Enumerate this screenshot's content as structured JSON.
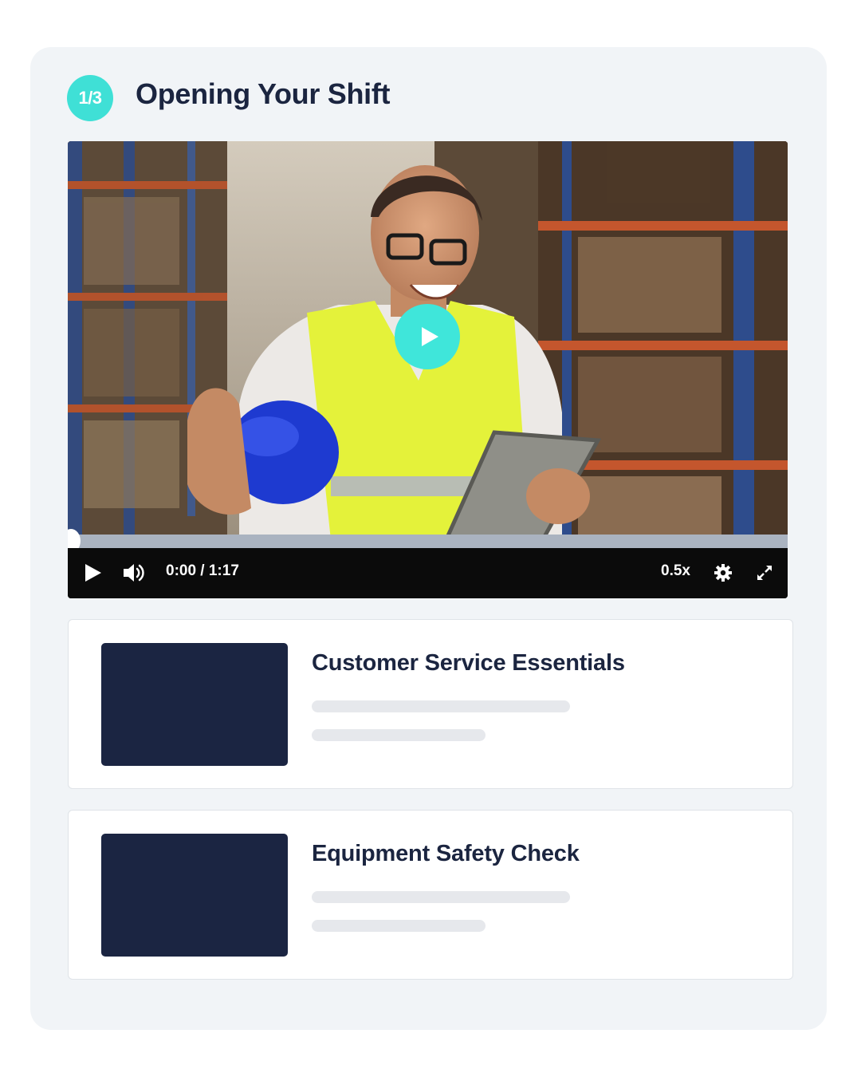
{
  "step": {
    "badge": "1/3",
    "title": "Opening Your Shift"
  },
  "player": {
    "time_display": "0:00 / 1:17",
    "speed_label": "0.5x",
    "progress": 0,
    "icons": {
      "center_play": "play-icon",
      "play": "play-icon",
      "volume": "volume-icon",
      "settings": "gear-icon",
      "fullscreen": "fullscreen-icon"
    }
  },
  "courses": [
    {
      "title": "Customer Service Essentials"
    },
    {
      "title": "Equipment Safety Check"
    }
  ],
  "colors": {
    "accent": "#3fe0d6",
    "title_text": "#1b2540",
    "thumbnail": "#1b2542",
    "panel_bg": "#f1f4f7"
  }
}
